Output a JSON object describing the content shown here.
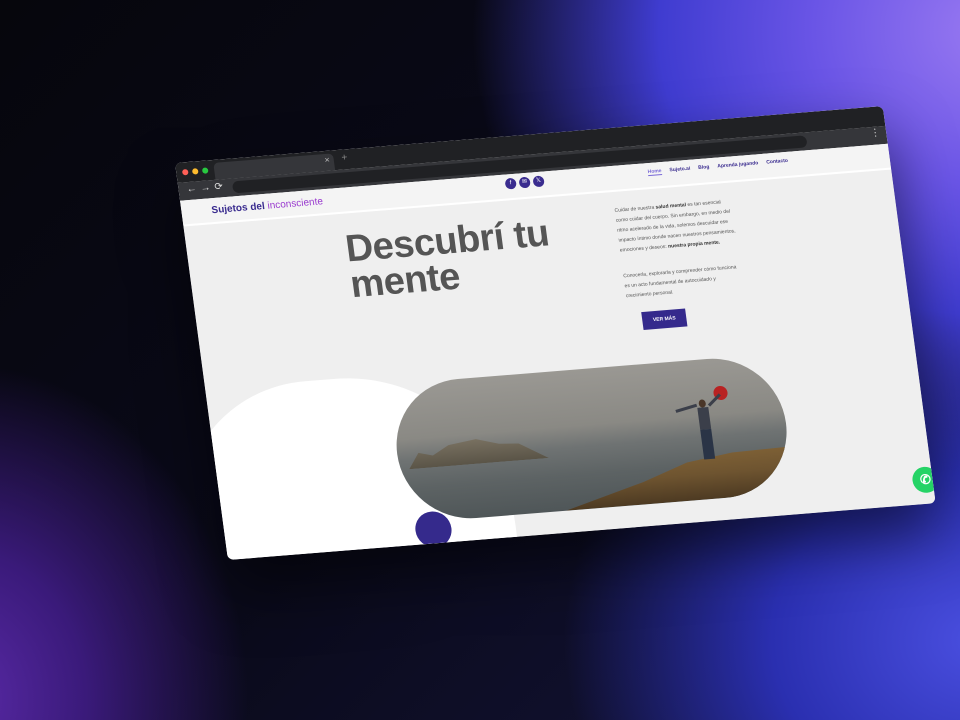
{
  "browser": {
    "tab_close": "×",
    "new_tab": "+",
    "back": "←",
    "forward": "→",
    "reload": "⟳",
    "menu": "⋮"
  },
  "site": {
    "logo": {
      "main": "Sujetos del ",
      "accent": "inconsciente"
    },
    "socials": [
      {
        "icon": "facebook-icon",
        "glyph": "f"
      },
      {
        "icon": "email-icon",
        "glyph": "✉"
      },
      {
        "icon": "x-icon",
        "glyph": "𝕏"
      }
    ],
    "menu": [
      "Home",
      "Sujeto.ai",
      "Blog",
      "Aprenda jugando",
      "Contacto"
    ],
    "hero": {
      "title_line1": "Descubrí tu",
      "title_line2": "mente",
      "paragraph1_a": "Cuidar de nuestra ",
      "paragraph1_b": "salud mental",
      "paragraph1_c": " es tan esencial como cuidar del cuerpo. Sin embargo, en medio del ritmo acelerado de la vida, solemos descuidar ese impacto íntimo donde nacen nuestros pensamientos, emociones y deseos: ",
      "paragraph1_d": "nuestra propia mente.",
      "paragraph2": "Conocerla, explorarla y comprender cómo funciona es un acto fundamental de autocuidado y crecimiento personal.",
      "cta": "VER MÁS"
    },
    "whatsapp_glyph": "✆"
  },
  "colors": {
    "brand": "#3a2c8f",
    "accent": "#9a3ccf",
    "whatsapp": "#25d366"
  }
}
